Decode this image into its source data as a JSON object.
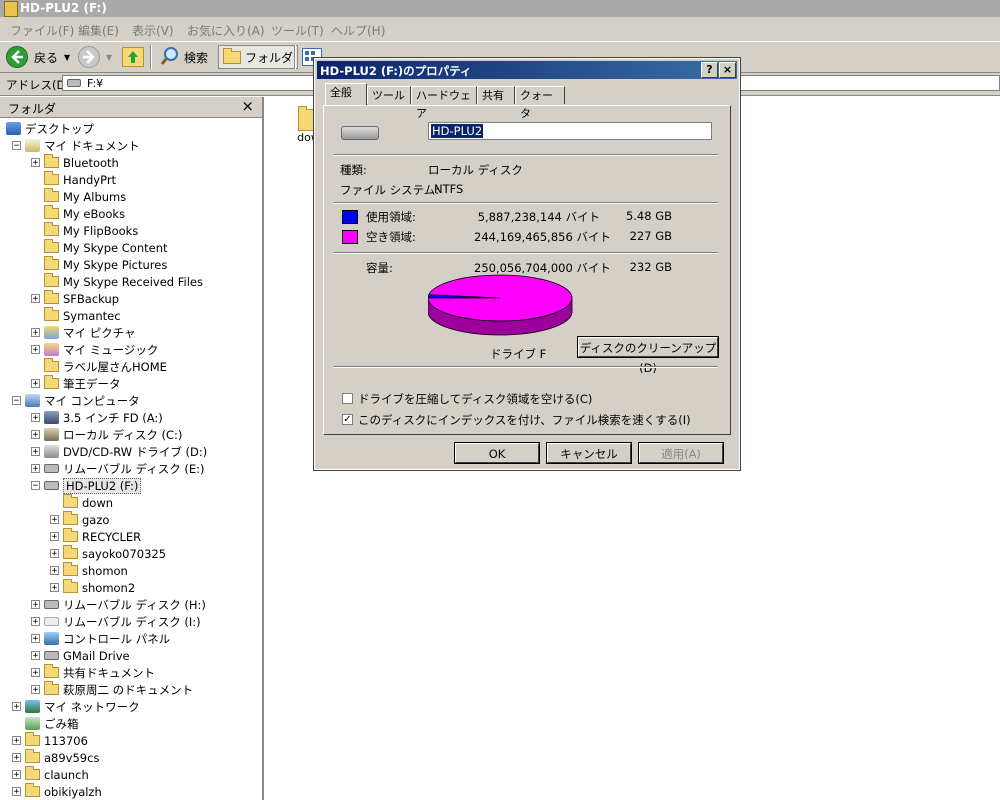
{
  "window": {
    "title": "HD-PLU2 (F:)"
  },
  "menu": {
    "items": [
      "ファイル(F)",
      "編集(E)",
      "表示(V)",
      "お気に入り(A)",
      "ツール(T)",
      "ヘルプ(H)"
    ]
  },
  "toolbar": {
    "back_label": "戻る",
    "search_label": "検索",
    "folders_label": "フォルダ"
  },
  "address": {
    "label": "アドレス(D)",
    "value": "F:¥"
  },
  "folder_pane": {
    "header": "フォルダ",
    "close_glyph": "×",
    "tree": [
      {
        "label": "デスクトップ",
        "level": 0,
        "expander": "",
        "icon": "desktop"
      },
      {
        "label": "マイ ドキュメント",
        "level": 1,
        "expander": "−",
        "icon": "mydocs"
      },
      {
        "label": "Bluetooth",
        "level": 2,
        "expander": "+",
        "icon": "folder"
      },
      {
        "label": "HandyPrt",
        "level": 2,
        "expander": "",
        "icon": "folder"
      },
      {
        "label": "My Albums",
        "level": 2,
        "expander": "",
        "icon": "folder"
      },
      {
        "label": "My eBooks",
        "level": 2,
        "expander": "",
        "icon": "folder"
      },
      {
        "label": "My FlipBooks",
        "level": 2,
        "expander": "",
        "icon": "folder"
      },
      {
        "label": "My Skype Content",
        "level": 2,
        "expander": "",
        "icon": "folder"
      },
      {
        "label": "My Skype Pictures",
        "level": 2,
        "expander": "",
        "icon": "folder"
      },
      {
        "label": "My Skype Received Files",
        "level": 2,
        "expander": "",
        "icon": "folder"
      },
      {
        "label": "SFBackup",
        "level": 2,
        "expander": "+",
        "icon": "folder"
      },
      {
        "label": "Symantec",
        "level": 2,
        "expander": "",
        "icon": "folder"
      },
      {
        "label": "マイ ピクチャ",
        "level": 2,
        "expander": "+",
        "icon": "pictures"
      },
      {
        "label": "マイ ミュージック",
        "level": 2,
        "expander": "+",
        "icon": "music"
      },
      {
        "label": "ラベル屋さんHOME",
        "level": 2,
        "expander": "",
        "icon": "folder"
      },
      {
        "label": "筆王データ",
        "level": 2,
        "expander": "+",
        "icon": "folder"
      },
      {
        "label": "マイ コンピュータ",
        "level": 1,
        "expander": "−",
        "icon": "computer"
      },
      {
        "label": "3.5 インチ FD (A:)",
        "level": 2,
        "expander": "+",
        "icon": "floppy"
      },
      {
        "label": "ローカル ディスク (C:)",
        "level": 2,
        "expander": "+",
        "icon": "hdd"
      },
      {
        "label": "DVD/CD-RW ドライブ (D:)",
        "level": 2,
        "expander": "+",
        "icon": "dvd"
      },
      {
        "label": "リムーバブル ディスク (E:)",
        "level": 2,
        "expander": "+",
        "icon": "drive"
      },
      {
        "label": "HD-PLU2 (F:)",
        "level": 2,
        "expander": "−",
        "icon": "drive",
        "selected": true
      },
      {
        "label": "down",
        "level": 3,
        "expander": "",
        "icon": "folder"
      },
      {
        "label": "gazo",
        "level": 3,
        "expander": "+",
        "icon": "folder"
      },
      {
        "label": "RECYCLER",
        "level": 3,
        "expander": "+",
        "icon": "folder"
      },
      {
        "label": "sayoko070325",
        "level": 3,
        "expander": "+",
        "icon": "folder"
      },
      {
        "label": "shomon",
        "level": 3,
        "expander": "+",
        "icon": "folder"
      },
      {
        "label": "shomon2",
        "level": 3,
        "expander": "+",
        "icon": "folder"
      },
      {
        "label": "リムーバブル ディスク (H:)",
        "level": 2,
        "expander": "+",
        "icon": "drive"
      },
      {
        "label": "リムーバブル ディスク (I:)",
        "level": 2,
        "expander": "+",
        "icon": "drive-gray"
      },
      {
        "label": "コントロール パネル",
        "level": 2,
        "expander": "+",
        "icon": "control"
      },
      {
        "label": "GMail Drive",
        "level": 2,
        "expander": "+",
        "icon": "drive"
      },
      {
        "label": "共有ドキュメント",
        "level": 2,
        "expander": "+",
        "icon": "folder"
      },
      {
        "label": "萩原周二 のドキュメント",
        "level": 2,
        "expander": "+",
        "icon": "folder"
      },
      {
        "label": "マイ ネットワーク",
        "level": 1,
        "expander": "+",
        "icon": "network"
      },
      {
        "label": "ごみ箱",
        "level": 1,
        "expander": "",
        "icon": "recycle"
      },
      {
        "label": "113706",
        "level": 1,
        "expander": "+",
        "icon": "folder"
      },
      {
        "label": "a89v59cs",
        "level": 1,
        "expander": "+",
        "icon": "folder"
      },
      {
        "label": "claunch",
        "level": 1,
        "expander": "+",
        "icon": "folder"
      },
      {
        "label": "obikiyalzh",
        "level": 1,
        "expander": "+",
        "icon": "folder"
      }
    ]
  },
  "right_pane": {
    "items": [
      {
        "label": "down"
      }
    ]
  },
  "dialog": {
    "title": "HD-PLU2 (F:)のプロパティ",
    "help_glyph": "?",
    "close_glyph": "×",
    "tabs": [
      "全般",
      "ツール",
      "ハードウェア",
      "共有",
      "クォータ"
    ],
    "active_tab": 0,
    "name_value": "HD-PLU2",
    "type_label": "種類:",
    "type_value": "ローカル ディスク",
    "fs_label": "ファイル システム:",
    "fs_value": "NTFS",
    "used_label": "使用領域:",
    "used_bytes": "5,887,238,144 バイト",
    "used_gb": "5.48 GB",
    "used_color": "#0000ff",
    "free_label": "空き領域:",
    "free_bytes": "244,169,465,856 バイト",
    "free_gb": "227 GB",
    "free_color": "#ff00ff",
    "capacity_label": "容量:",
    "capacity_bytes": "250,056,704,000 バイト",
    "capacity_gb": "232 GB",
    "drive_label": "ドライブ F",
    "cleanup_label": "ディスクのクリーンアップ(D)",
    "compress_label": "ドライブを圧縮してディスク領域を空ける(C)",
    "compress_checked": false,
    "index_label": "このディスクにインデックスを付け、ファイル検索を速くする(I)",
    "index_checked": true,
    "ok_label": "OK",
    "cancel_label": "キャンセル",
    "apply_label": "適用(A)"
  },
  "chart_data": {
    "type": "pie",
    "categories": [
      "使用領域",
      "空き領域"
    ],
    "values": [
      5887238144,
      244169465856
    ],
    "colors": [
      "#0000ff",
      "#ff00ff"
    ],
    "title": "ドライブ F"
  }
}
